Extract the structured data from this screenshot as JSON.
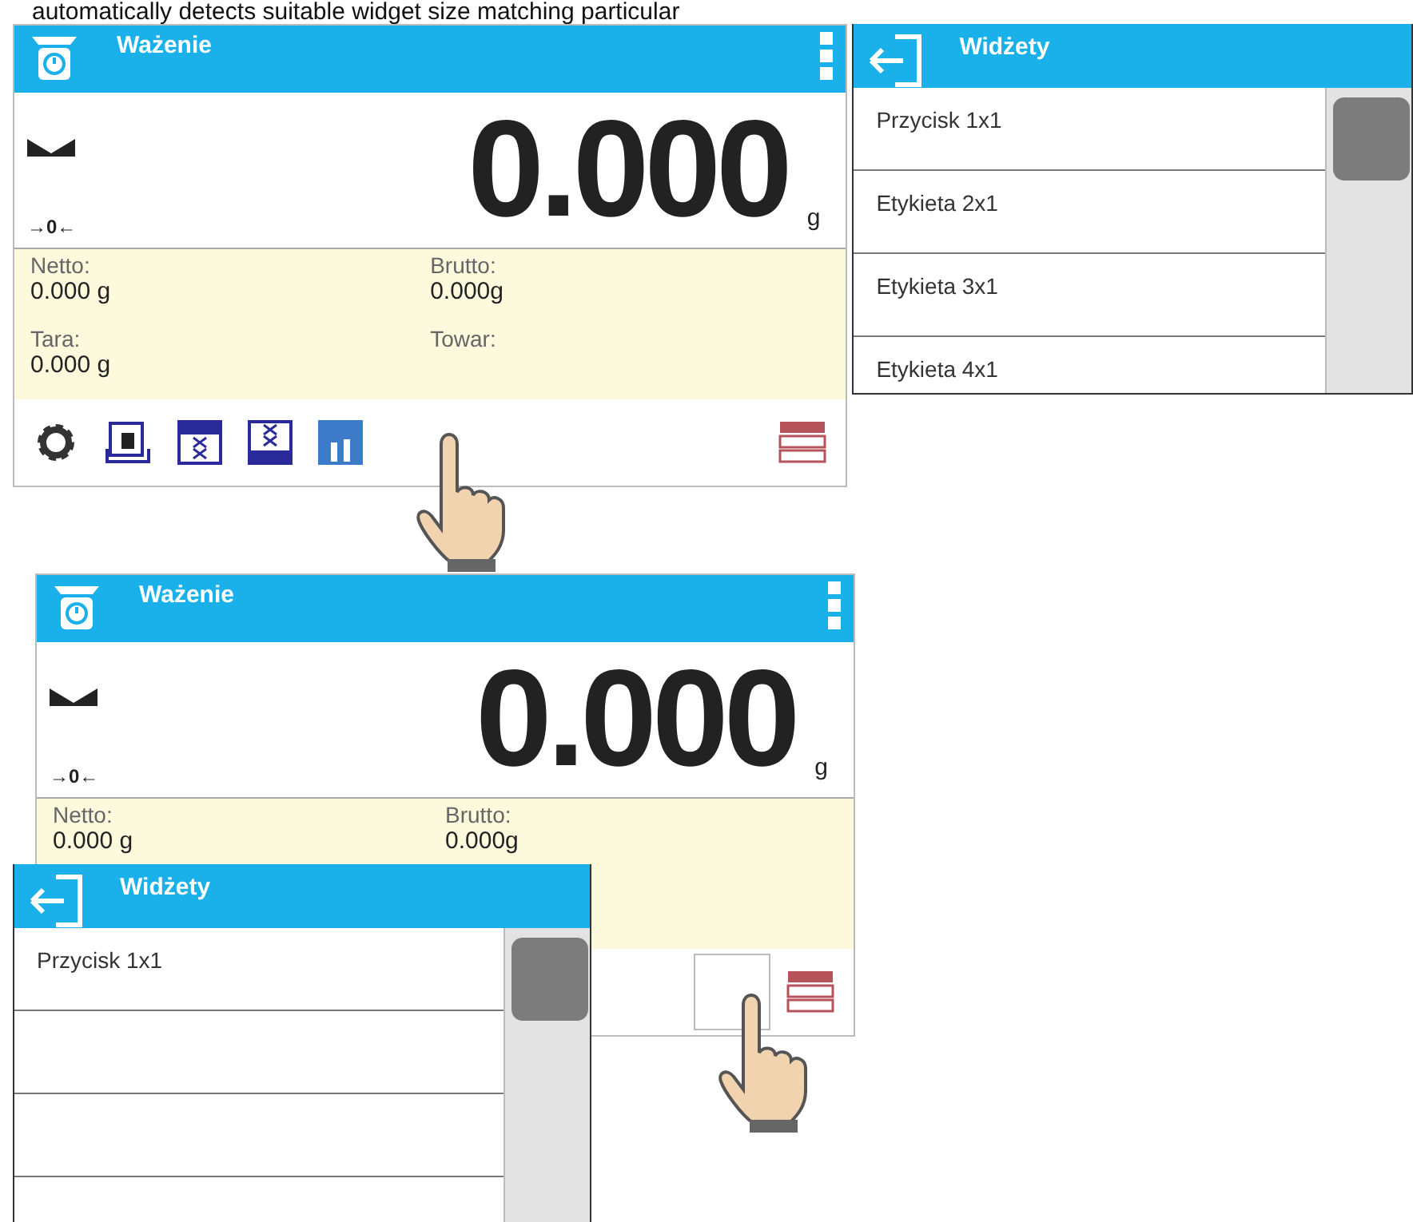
{
  "caption": "automatically detects suitable widget size matching particular",
  "screen_before": {
    "title": "Ważenie",
    "reading": "0.000",
    "unit": "g",
    "zero_mark": "→0←",
    "fields": [
      {
        "label": "Netto:",
        "value": "0.000 g"
      },
      {
        "label": "Brutto:",
        "value": "0.000g"
      },
      {
        "label": "Tara:",
        "value": "0.000 g"
      },
      {
        "label": "Towar:"
      }
    ],
    "toolbar": [
      {
        "kind": "settings"
      },
      {
        "kind": "tare"
      },
      {
        "kind": "widget-top"
      },
      {
        "kind": "widget-bottom"
      },
      {
        "kind": "chart"
      },
      {
        "kind": "database"
      }
    ]
  },
  "widgets_panel": {
    "title": "Widżety",
    "items": [
      "Przycisk 1x1",
      "Etykieta 2x1",
      "Etykieta 3x1",
      "Etykieta 4x1"
    ]
  },
  "screen_after": {
    "title": "Ważenie",
    "reading": "0.000",
    "unit": "g",
    "zero_mark": "→0←",
    "fields": [
      {
        "label": "Netto:",
        "value": "0.000 g"
      },
      {
        "label": "Brutto:",
        "value": "0.000g"
      }
    ],
    "toolbar": [
      {
        "kind": "slot"
      },
      {
        "kind": "database"
      }
    ]
  },
  "widgets_popup": {
    "title": "Widżety",
    "items": [
      "Przycisk 1x1"
    ]
  }
}
